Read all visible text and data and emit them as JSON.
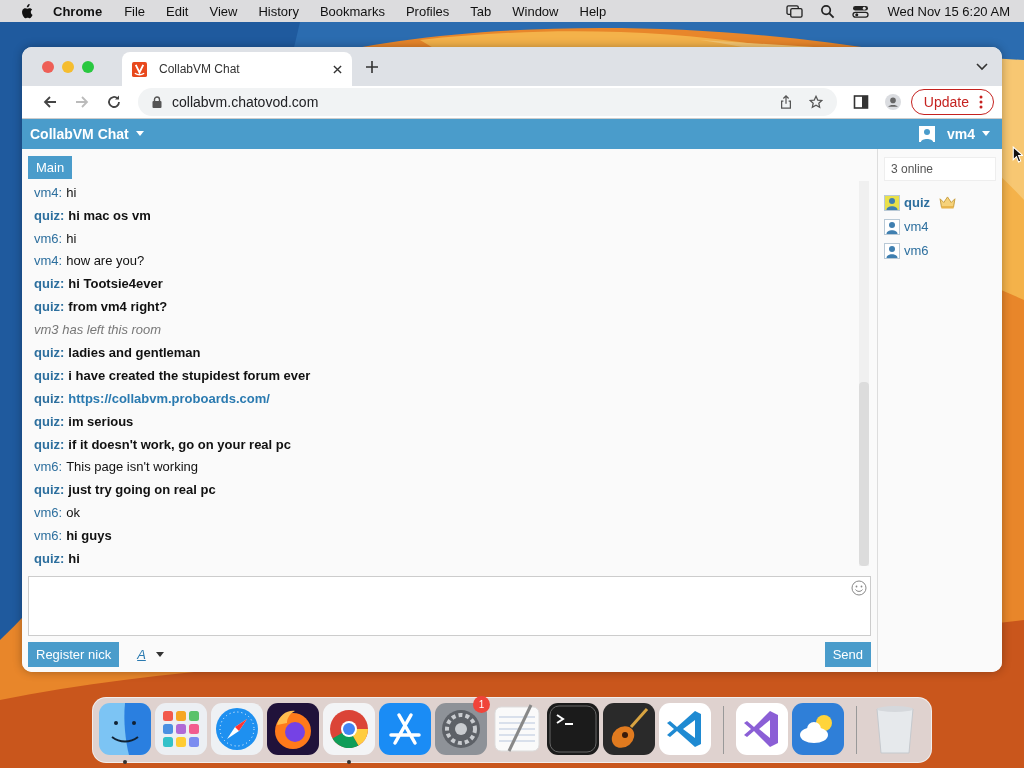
{
  "menubar": {
    "app": "Chrome",
    "menus": [
      "File",
      "Edit",
      "View",
      "History",
      "Bookmarks",
      "Profiles",
      "Tab",
      "Window",
      "Help"
    ],
    "clock": "Wed Nov 15  6:20 AM"
  },
  "browser": {
    "tab": {
      "title": "CollabVM Chat",
      "selected": true
    },
    "url": "collabvm.chatovod.com",
    "forward_disabled": true,
    "update_button": "Update"
  },
  "chat": {
    "title": "CollabVM Chat",
    "user": "vm4",
    "rooms": [
      {
        "label": "Main",
        "selected": true
      }
    ],
    "messages": [
      {
        "kind": "message",
        "user": "vm4:",
        "user_bold": false,
        "text": "hi",
        "bold": false
      },
      {
        "kind": "message",
        "user": "quiz:",
        "user_bold": true,
        "text": "hi mac os vm",
        "bold": true
      },
      {
        "kind": "message",
        "user": "vm6:",
        "user_bold": false,
        "text": "hi",
        "bold": false
      },
      {
        "kind": "message",
        "user": "vm4:",
        "user_bold": false,
        "text": "how are you?",
        "bold": false
      },
      {
        "kind": "message",
        "user": "quiz:",
        "user_bold": true,
        "text": "hi Tootsie4ever",
        "bold": true
      },
      {
        "kind": "message",
        "user": "quiz:",
        "user_bold": true,
        "text": "from vm4 right?",
        "bold": true
      },
      {
        "kind": "system",
        "text": "vm3 has left this room"
      },
      {
        "kind": "message",
        "user": "quiz:",
        "user_bold": true,
        "text": "ladies and gentleman",
        "bold": true
      },
      {
        "kind": "message",
        "user": "quiz:",
        "user_bold": true,
        "text": "i have created the stupidest forum ever",
        "bold": true
      },
      {
        "kind": "link",
        "user": "quiz:",
        "user_bold": true,
        "text": "https://collabvm.proboards.com/",
        "bold": true
      },
      {
        "kind": "message",
        "user": "quiz:",
        "user_bold": true,
        "text": "im serious",
        "bold": true
      },
      {
        "kind": "message",
        "user": "quiz:",
        "user_bold": true,
        "text": "if it doesn't work, go on your real pc",
        "bold": true
      },
      {
        "kind": "message",
        "user": "vm6:",
        "user_bold": false,
        "text": "This page isn't working",
        "bold": false
      },
      {
        "kind": "message",
        "user": "quiz:",
        "user_bold": true,
        "text": "just try going on real pc",
        "bold": true
      },
      {
        "kind": "message",
        "user": "vm6:",
        "user_bold": false,
        "text": "ok",
        "bold": false
      },
      {
        "kind": "message",
        "user": "vm6:",
        "user_bold": false,
        "text": "hi guys",
        "bold": true
      },
      {
        "kind": "message",
        "user": "quiz:",
        "user_bold": true,
        "text": "hi",
        "bold": true
      }
    ],
    "register_button": "Register nick",
    "font_button": "A",
    "send_button": "Send",
    "online_count": "3 online",
    "users": [
      {
        "name": "quiz",
        "admin": true
      },
      {
        "name": "vm4",
        "admin": false
      },
      {
        "name": "vm6",
        "admin": false
      }
    ]
  },
  "dock": {
    "items": [
      {
        "kind": "finder",
        "running": true
      },
      {
        "kind": "launchpad",
        "running": false
      },
      {
        "kind": "safari",
        "running": false
      },
      {
        "kind": "firefox",
        "running": false
      },
      {
        "kind": "chrome",
        "running": true
      },
      {
        "kind": "appstore",
        "running": false
      },
      {
        "kind": "settings",
        "running": false,
        "badge": "1"
      },
      {
        "kind": "textedit",
        "running": false
      },
      {
        "kind": "terminal",
        "running": false
      },
      {
        "kind": "garageband",
        "running": false
      },
      {
        "kind": "vscode",
        "running": false
      },
      {
        "kind": "separator"
      },
      {
        "kind": "visualstudio",
        "running": false
      },
      {
        "kind": "weather",
        "running": false
      },
      {
        "kind": "separator"
      },
      {
        "kind": "trash",
        "running": false
      }
    ]
  }
}
